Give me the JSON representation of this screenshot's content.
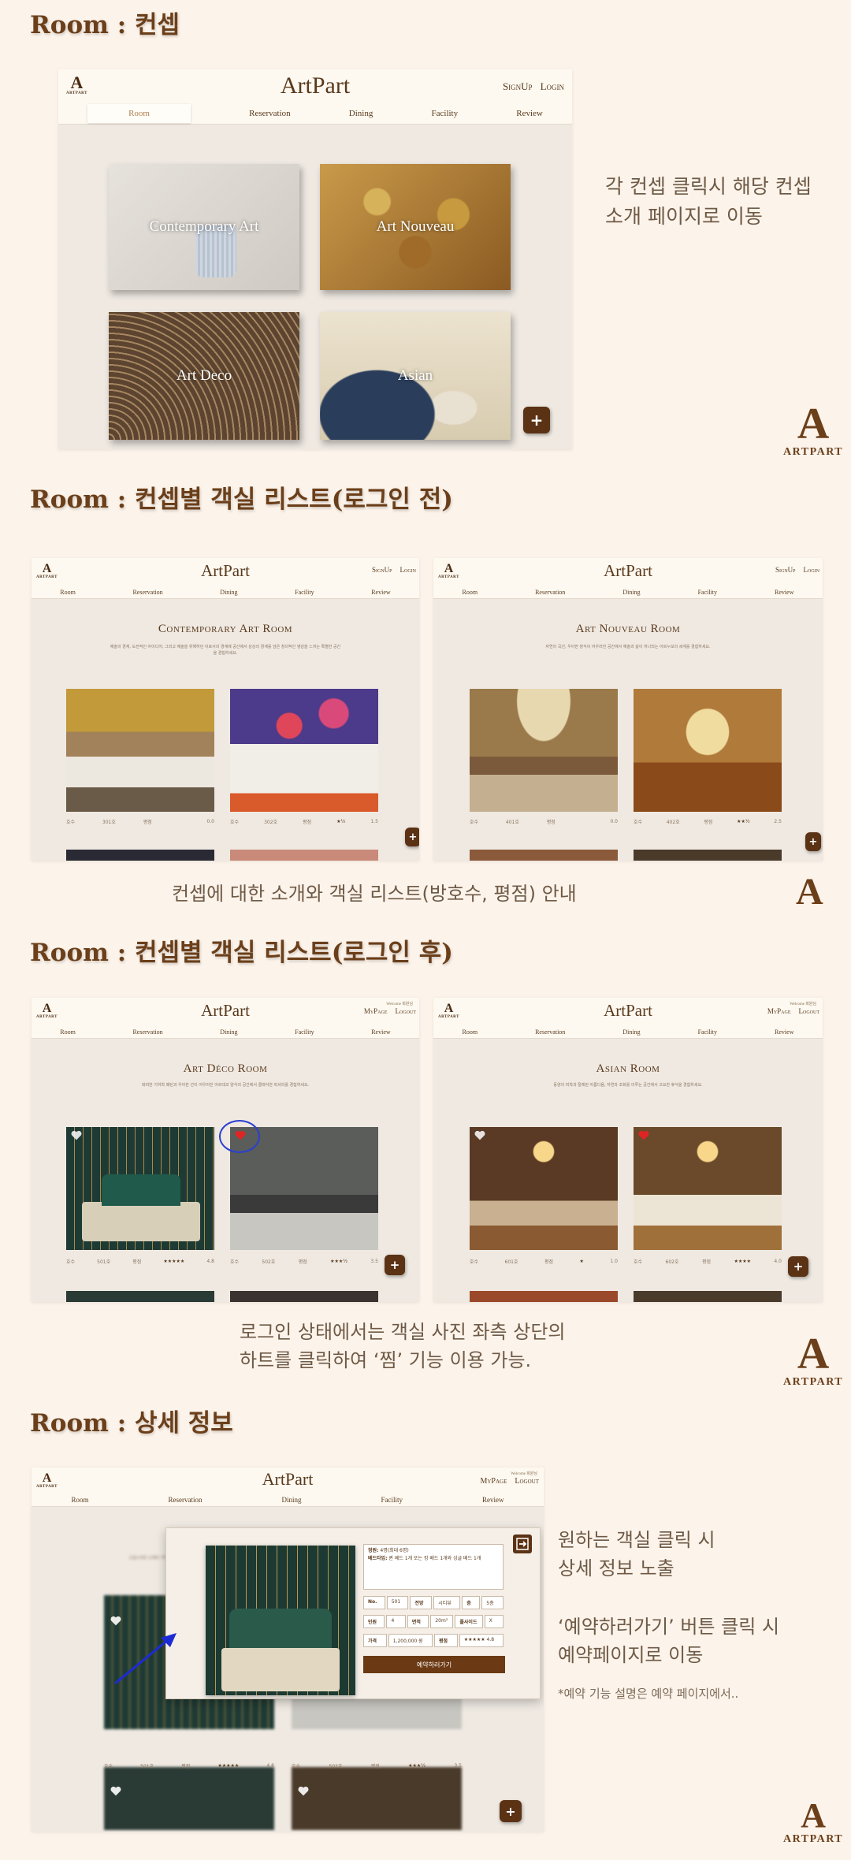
{
  "sections": {
    "s1": "Room : 컨셉",
    "s2": "Room : 컨셉별 객실 리스트(로그인 전)",
    "s3": "Room : 컨셉별 객실 리스트(로그인 후)",
    "s4": "Room : 상세 정보"
  },
  "site": {
    "brand": "ArtPart",
    "logo_text": "ARTPART",
    "nav": [
      "Room",
      "Reservation",
      "Dining",
      "Facility",
      "Review"
    ],
    "signup": "SignUp",
    "login": "Login",
    "mypage": "MyPage",
    "logout": "Logout",
    "welcome": "Welcome 회원님",
    "plus": "+"
  },
  "concepts": [
    "Contemporary Art",
    "Art Nouveau",
    "Art Deco",
    "Asian"
  ],
  "notes": {
    "n1": [
      "각 컨셉 클릭시 해당 컨셉",
      "소개 페이지로 이동"
    ],
    "n2": "컨셉에 대한 소개와 객실 리스트(방호수, 평점) 안내",
    "n3": [
      "로그인 상태에서는 객실 사진 좌측 상단의",
      "하트를 클릭하여 ‘찜’ 기능 이용 가능."
    ],
    "n4a": [
      "원하는 객실 클릭 시",
      "상세 정보 노출"
    ],
    "n4b": [
      "‘예약하러가기’ 버튼 클릭 시",
      "예약페이지로 이동"
    ],
    "n4c": "*예약 기능 설명은 예약 페이지에서.."
  },
  "rooms_pages": [
    {
      "title": "Contemporary Art Room",
      "desc": "예술의 경계, 도전적인 아이디어, 그리고 예술을 위해하던 이로서의 경계에 공간에서 상상의 경계를 넘은 창의적인 영감을 느끼는 특별한 공간을 경험하세요.",
      "rooms": [
        {
          "floor": "호수",
          "no": "301호",
          "label": "평점",
          "stars": "",
          "score": "0.0"
        },
        {
          "floor": "호수",
          "no": "302호",
          "label": "평점",
          "stars": "★½",
          "score": "1.5"
        }
      ]
    },
    {
      "title": "Art Nouveau Room",
      "desc": "자연의 곡선, 우아한 장식이 어우러진 공간에서 예술과 삶이 하나되는 아르누보의 세계를 경험하세요.",
      "rooms": [
        {
          "floor": "호수",
          "no": "401호",
          "label": "평점",
          "stars": "",
          "score": "0.0"
        },
        {
          "floor": "호수",
          "no": "402호",
          "label": "평점",
          "stars": "★★½",
          "score": "2.5"
        }
      ]
    },
    {
      "title": "Art Déco Room",
      "desc": "화려한 기하학 패턴과 우아한 선이 어우러진 아르데코 양식의 공간에서 클래식한 럭셔리를 경험하세요.",
      "rooms": [
        {
          "floor": "호수",
          "no": "501호",
          "label": "평점",
          "stars": "★★★★★",
          "score": "4.8"
        },
        {
          "floor": "호수",
          "no": "502호",
          "label": "평점",
          "stars": "★★★½",
          "score": "3.5"
        }
      ]
    },
    {
      "title": "Asian Room",
      "desc": "동양의 미학과 절제된 아름다움, 자연과 조화를 이루는 공간에서 고요한 휴식을 경험하세요.",
      "rooms": [
        {
          "floor": "호수",
          "no": "601호",
          "label": "평점",
          "stars": "★",
          "score": "1.0"
        },
        {
          "floor": "호수",
          "no": "602호",
          "label": "평점",
          "stars": "★★★★",
          "score": "4.0"
        }
      ]
    }
  ],
  "detail": {
    "page_title": "Art Déco Room",
    "desc_line": "고급스러운 소재와 기하학적 패턴이 어우러진 공간",
    "room_name_label": "정원:",
    "room_name_value": "4명(최대 6명)",
    "bed_label": "베드타입:",
    "bed_value": "퀸 베드 1개 또는 킹 베드 1개와 싱글 베드 1개",
    "no_label": "No.",
    "no_value": "501",
    "view_label": "전망",
    "view_value": "시티뷰",
    "floor_label": "층",
    "floor_value": "5층",
    "people_label": "인원",
    "people_value": "4",
    "area_label": "면적",
    "area_value": "20m²",
    "pool_label": "풀사이드",
    "pool_value": "X",
    "price_label": "가격",
    "price_value": "1,200,000 원",
    "rating_label": "평점",
    "rating_stars": "★★★★★",
    "rating_value": "4.8",
    "reserve_button": "예약하러가기",
    "list": [
      {
        "floor": "호수",
        "no": "501호",
        "label": "평점",
        "stars": "★★★★★",
        "score": "4.8"
      },
      {
        "floor": "호수",
        "no": "502호",
        "label": "평점",
        "stars": "★★★½",
        "score": "3.5"
      }
    ]
  },
  "colors": {
    "background": "#fcf3ea",
    "accent": "#6b3f1a",
    "button": "#5b3214",
    "heart": "#e02424",
    "highlight_circle": "#2a3fd1",
    "arrow": "#1c2bd4"
  }
}
